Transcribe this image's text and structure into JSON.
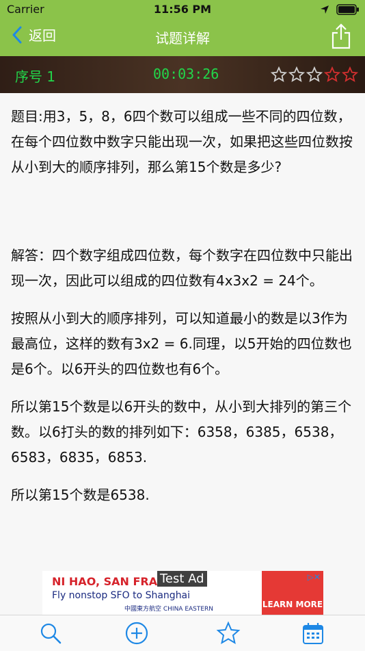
{
  "status": {
    "carrier": "Carrier",
    "time": "11:56 PM"
  },
  "nav": {
    "back_label": "返回",
    "title": "试题详解"
  },
  "info": {
    "sequence": "序号 1",
    "timer": "00:03:26",
    "rating_stars": 5,
    "accent": "#22d64a"
  },
  "question": "题目:用3，5，8，6四个数可以组成一些不同的四位数，在每个四位数中数字只能出现一次，如果把这些四位数按从小到大的顺序排列，那么第15个数是多少?",
  "answer": [
    "解答：四个数字组成四位数，每个数字在四位数中只能出现一次，因此可以组成的四位数有4x3x2 = 24个。",
    "按照从小到大的顺序排列，可以知道最小的数是以3作为最高位，这样的数有3x2 = 6.同理，以5开始的四位数也是6个。以6开头的四位数也有6个。",
    "所以第15个数是以6开头的数中，从小到大排列的第三个数。以6打头的数的排列如下：6358，6385，6538，6583，6835，6853.",
    "所以第15个数是6538."
  ],
  "ad": {
    "headline": "NI HAO, SAN FRA",
    "subline": "Fly nonstop SFO to Shanghai",
    "brand": "中國東方航空 CHINA EASTERN",
    "cta": "LEARN MORE",
    "test_label": "Test Ad"
  },
  "colors": {
    "nav_bg": "#8bc34a",
    "ios_blue": "#1e88e5",
    "star_red": "#d32f2f"
  },
  "tabs": [
    "search-icon",
    "add-circle-icon",
    "star-icon",
    "calendar-icon"
  ]
}
